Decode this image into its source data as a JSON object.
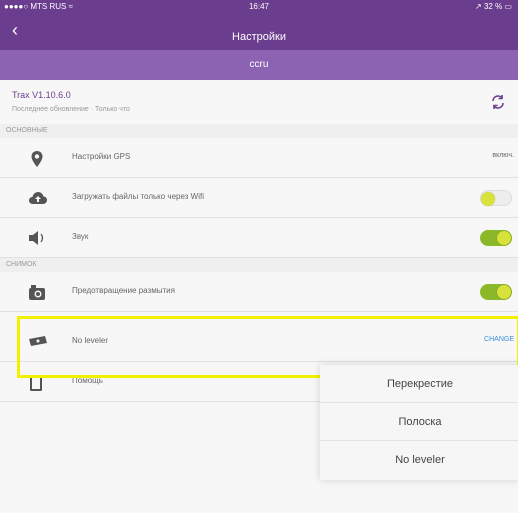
{
  "statusbar": {
    "carrier": "●●●●○ MTS RUS ≈",
    "time": "16:47",
    "battery": "↗ 32 % ▭"
  },
  "navbar": {
    "back_icon": "chevron-left",
    "title": "Настройки"
  },
  "subbar": {
    "account": "ccru"
  },
  "version": {
    "title": "Trax V1.10.6.0",
    "subtitle": "Последнее обновление · Только что",
    "sync_icon": "sync-icon"
  },
  "sections": {
    "basic": "ОСНОВНЫЕ",
    "snapshot": "СНИМОК"
  },
  "rows": {
    "gps": {
      "label": "Настройки GPS",
      "value": "включ."
    },
    "wifi": {
      "label": "Загружать файлы только через Wifi",
      "toggle": false
    },
    "sound": {
      "label": "Звук",
      "toggle": true
    },
    "blur": {
      "label": "Предотвращение размытия",
      "toggle": true
    },
    "leveler": {
      "label": "No leveler",
      "action": "CHANGE"
    },
    "help": {
      "label": "Помощь"
    }
  },
  "popover": {
    "options": [
      "Перекрестие",
      "Полоска",
      "No leveler"
    ]
  },
  "colors": {
    "brand": "#6b3d8e",
    "accent": "#8bb829",
    "link": "#3a8edb",
    "highlight": "#f2f200"
  }
}
